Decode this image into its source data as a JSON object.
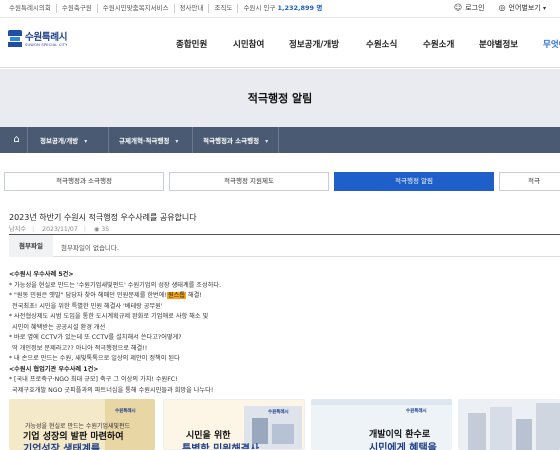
{
  "utility": {
    "links": [
      "수원특례시의회",
      "수원축구원",
      "수원시민맞춤복지서비스",
      "정사안내",
      "조직도"
    ],
    "population_label": "수원시 인구",
    "population_value": "1,232,899 명",
    "login": "로그인",
    "language": "언어별보기"
  },
  "logo": {
    "name": "수원특례시",
    "sub": "SUWON SPECIAL CITY"
  },
  "gnb": [
    "종합민원",
    "시민참여",
    "정보공개/개방",
    "수원소식",
    "수원소개",
    "분야별정보",
    "무엇이"
  ],
  "page_title": "적극행정 알림",
  "breadcrumb": [
    "정보공개/개방",
    "규제개혁·적극행정",
    "적극행정과 소극행정"
  ],
  "tabs": [
    "적극행정과 소극행정",
    "적극행정 지원제도",
    "적극행정 알림",
    "적극"
  ],
  "article": {
    "title": "2023년 하반기 수원시 적극행정 우수사례를 공유합니다",
    "author": "남지수",
    "date": "2023/11/07",
    "views": "35",
    "attach_label": "첨부파일",
    "attach_value": "첨부파일이 없습니다."
  },
  "body": {
    "h1": "<수원시 우수사례 5건>",
    "l1": "* 가능성을 현실로 만드는 '수원기업새빛펀드' 수원기업의 성장 생태계를 조성하다.",
    "l2a": "* \"원동 민원은 옛말\" 담당자 찾아 헤매던 민원문제를 한번에!",
    "l2hl": "원스톱",
    "l2b": "해결!",
    "l3": "전국최초! 시민을 위한 특별한 민원 해결사 '베테랑 공무원'",
    "l4": "* 사전협상제도 시범 도입을 통한 도시계획규제 완화로 기업애로 사항 해소 및",
    "l5": "시민이 혜택받는 공공시설 환경 개선",
    "l6": "* 바로 옆에 CCTV가 있는데 또 CCTV를 설치해서 쓴다고?어떻게?",
    "l7": "딱 개인정보 문제라고?? 아니아 적극행정으로 해결!!",
    "l8": "* 내 손으로 만드는 수원, 새빛톡톡으로 일상의 제안이 정책이 된다",
    "h2": "<수원시 협업기관 우수사례 1건>",
    "l9": "* [국내 프로축구·NGO 최대 규모] 축구 그 이상의 가치! 수원FC!",
    "l10": "국제구호개발 NGO 굿피플과의 파트너십을 통해 수원시민들과 희망을 나누다!"
  },
  "thumbs": [
    {
      "logo": "수원특례시",
      "line1": "가능성을 현실로 만드는 수원기업새빛펀드",
      "line2": "기업 성장의 발판 마련하여",
      "line3": "기업성장 생태계를"
    },
    {
      "logo": "수원특례시",
      "line1": "",
      "line2": "시민을 위한",
      "line3": "특별한 민원해결사"
    },
    {
      "logo": "수원특례시",
      "line1": "",
      "line2": "개발이익 환수로",
      "line3": "시민에게 혜택을"
    }
  ],
  "colors": {
    "accent": "#1f5fc9",
    "breadcrumb_bg": "#4a5a72",
    "highlight": "#f7a21b",
    "title_band": "#e9ebf0"
  }
}
